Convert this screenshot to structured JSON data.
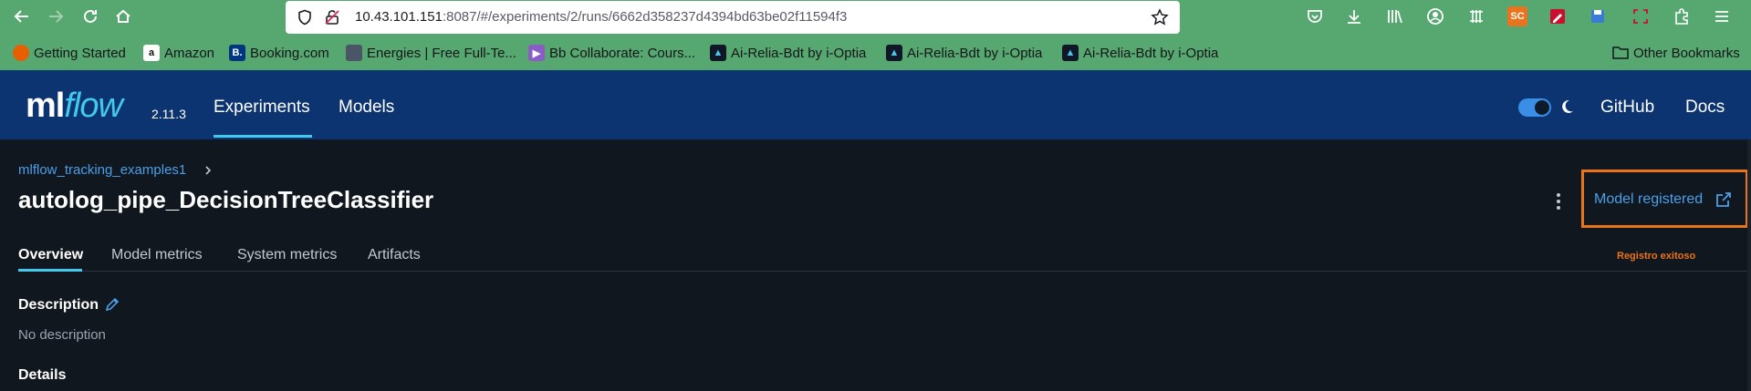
{
  "browser": {
    "url_host": "10.43.101.151",
    "url_path": ":8087/#/experiments/2/runs/6662d358237d4394bd63be02f11594f3",
    "extension_badge": "SC"
  },
  "bookmarks": [
    {
      "label": "Getting Started",
      "icon": "firefox-icon",
      "color": "#e66000"
    },
    {
      "label": "Amazon",
      "icon": "amazon-icon",
      "color": "#ffffff"
    },
    {
      "label": "Booking.com",
      "icon": "booking-icon",
      "color": "#003580"
    },
    {
      "label": "Energies | Free Full-Te...",
      "icon": "mdpi-icon",
      "color": "#4a5568"
    },
    {
      "label": "Bb Collaborate: Cours...",
      "icon": "collaborate-icon",
      "color": "#8a5cc7"
    },
    {
      "label": "Ai-Relia-Bdt by i-Optia",
      "icon": "ioptia-icon",
      "color": "#101828"
    },
    {
      "label": "Ai-Relia-Bdt by i-Optia",
      "icon": "ioptia-icon",
      "color": "#101828"
    },
    {
      "label": "Ai-Relia-Bdt by i-Optia",
      "icon": "ioptia-icon",
      "color": "#101828"
    }
  ],
  "other_bookmarks": "Other Bookmarks",
  "header": {
    "logo_ml": "ml",
    "logo_flow": "flow",
    "version": "2.11.3",
    "nav": [
      "Experiments",
      "Models"
    ],
    "links": [
      "GitHub",
      "Docs"
    ],
    "dark_mode": true
  },
  "run": {
    "breadcrumb": "mlflow_tracking_examples1",
    "title": "autolog_pipe_DecisionTreeClassifier",
    "model_registered": "Model registered",
    "annotation": "Registro exitoso",
    "tabs": [
      "Overview",
      "Model metrics",
      "System metrics",
      "Artifacts"
    ],
    "active_tab": "Overview",
    "description_title": "Description",
    "description_text": "No description",
    "details_title": "Details"
  },
  "colors": {
    "browser_green": "#56a870",
    "header_blue": "#0c3470",
    "accent_cyan": "#43c9ed",
    "link_blue": "#4a9fe8",
    "highlight_orange": "#e8741e",
    "page_bg": "#11171f"
  }
}
